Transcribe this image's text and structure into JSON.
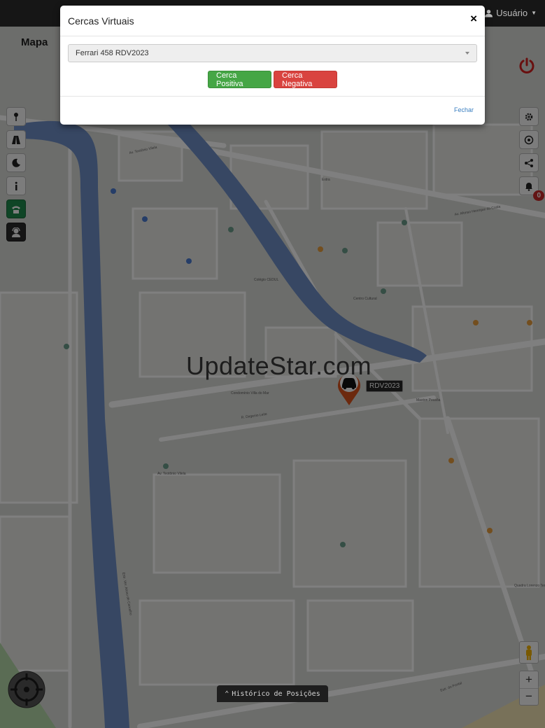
{
  "navbar": {
    "user_label": "Usuário"
  },
  "map": {
    "title": "Mapa",
    "watermark": "UpdateStar.com",
    "vehicle_tag": "RDV2023",
    "notification_count": "0",
    "history_label": "Histórico de Posições",
    "street_labels": [
      "Av. Teotônio Vilela",
      "Av. Afonso Henrique da Costa",
      "R. Dirgenio Leite",
      "Estr. Ver. Alceu de Carvalho",
      "Estr. do Pontal",
      "Av. Teotônio Vilela",
      "Condomínio Villa do Mar",
      "Centro Cultural",
      "Colégio CEDUL",
      "Maxton Pessôa",
      "Quadra Lorenzo Terremoto",
      "Extra"
    ]
  },
  "modal": {
    "title": "Cercas Virtuais",
    "close_label": "×",
    "selected_vehicle": "Ferrari 458 RDV2023",
    "positive_button": "Cerca Positiva",
    "negative_button": "Cerca Negativa",
    "close_footer": "Fechar"
  },
  "colors": {
    "navbar": "#161616",
    "positive": "#45a645",
    "negative": "#d9433f",
    "link": "#3a7fc1",
    "canal": "#6f8fc7"
  }
}
